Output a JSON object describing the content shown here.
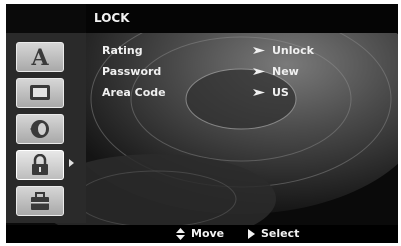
{
  "header": {
    "title": "LOCK"
  },
  "sidebar": {
    "tabs": [
      {
        "icon": "language-icon",
        "glyph": "A",
        "selected": false
      },
      {
        "icon": "display-icon",
        "selected": false
      },
      {
        "icon": "audio-icon",
        "selected": false
      },
      {
        "icon": "lock-icon",
        "selected": true
      },
      {
        "icon": "others-icon",
        "selected": false
      }
    ]
  },
  "menu": {
    "items": [
      {
        "label": "Rating",
        "value": "Unlock"
      },
      {
        "label": "Password",
        "value": "New"
      },
      {
        "label": "Area Code",
        "value": "US"
      }
    ]
  },
  "footer": {
    "move_label": "Move",
    "select_label": "Select"
  },
  "colors": {
    "text": "#f0f0f0",
    "tab_face": "#c4c4c4",
    "screen_bg": "#070707"
  }
}
